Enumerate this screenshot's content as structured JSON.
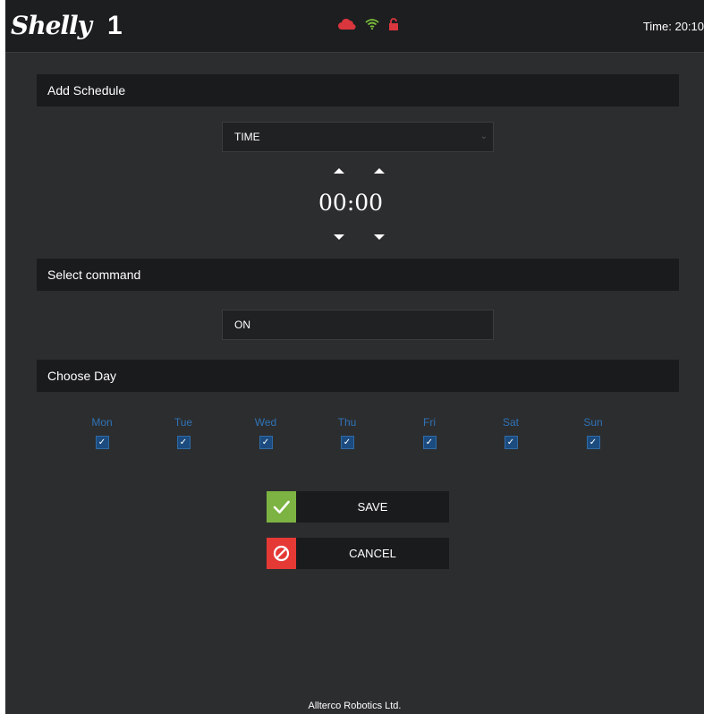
{
  "header": {
    "logo_text": "Shelly",
    "model": "1",
    "time_label": "Time: 20:10",
    "icons": [
      "cloud-icon",
      "wifi-icon",
      "lock-open-icon"
    ],
    "colors": {
      "cloud": "#d9363e",
      "wifi": "#7cc03a",
      "lock": "#d9363e"
    }
  },
  "schedule": {
    "section_title": "Add Schedule",
    "mode_select": "TIME",
    "hours": "00",
    "separator": ":",
    "minutes": "00"
  },
  "command": {
    "section_title": "Select command",
    "selected": "ON"
  },
  "days": {
    "section_title": "Choose Day",
    "items": [
      {
        "label": "Mon",
        "checked": true
      },
      {
        "label": "Tue",
        "checked": true
      },
      {
        "label": "Wed",
        "checked": true
      },
      {
        "label": "Thu",
        "checked": true
      },
      {
        "label": "Fri",
        "checked": true
      },
      {
        "label": "Sat",
        "checked": true
      },
      {
        "label": "Sun",
        "checked": true
      }
    ],
    "check_mark": "✓"
  },
  "actions": {
    "save_label": "SAVE",
    "cancel_label": "CANCEL",
    "save_color": "#7cb342",
    "cancel_color": "#e53935"
  },
  "footer": {
    "text": "Allterco Robotics Ltd."
  }
}
